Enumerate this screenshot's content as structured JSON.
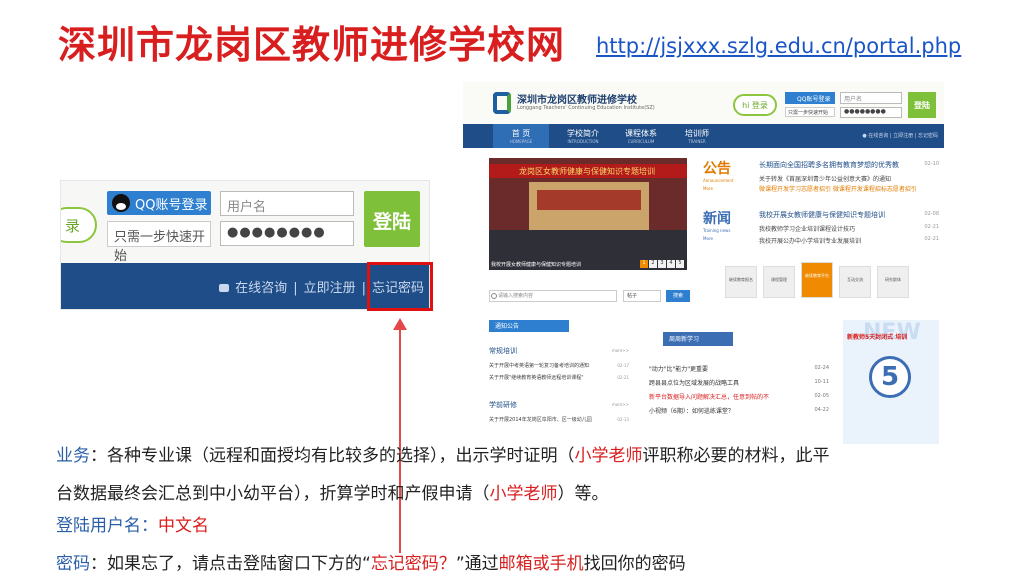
{
  "slide": {
    "title": "深圳市龙岗区教师进修学校网",
    "url": "http://jsjxxx.szlg.edu.cn/portal.php"
  },
  "zoom_login": {
    "hi_fragment": "录",
    "qq_login": "QQ账号登录",
    "quick_start_hint": "只需一步快速开始",
    "username_placeholder": "用户名",
    "password_value": "●●●●●●●●",
    "login_button": "登陆",
    "online_consult": "在线咨询",
    "separator": "|",
    "register_now": "立即注册",
    "forgot_password": "忘记密码"
  },
  "site": {
    "logo_cn": "深圳市龙岗区教师进修学校",
    "logo_en": "Longgang Teachers' Continuing Education Institute(SZ)",
    "hi_login": "hi 登录",
    "qq_login": "QQ账号登录",
    "qq_hint": "只需一步快速开始",
    "username": "用户名",
    "password": "●●●●●●●●",
    "login": "登陆",
    "nav": [
      {
        "label": "首 页",
        "sub": "HOMEPAGE"
      },
      {
        "label": "学校简介",
        "sub": "INTRODUCTION"
      },
      {
        "label": "课程体系",
        "sub": "CURRICULUM"
      },
      {
        "label": "培训师",
        "sub": "TRAINER"
      }
    ],
    "nav_right": "● 在线咨询 | 立即注册 | 忘记密码",
    "photo_banner": "龙岗区女教师健康与保健知识专题培训",
    "photo_caption": "我校开展女教师健康与保健知识专题培训",
    "pager": [
      "1",
      "2",
      "3",
      "4",
      "5"
    ],
    "notice_tag": "公告",
    "notice_sub": "Announcement",
    "notice_more": "More",
    "notice_lines": [
      {
        "text": "长期面向全国招聘多名拥有教育梦想的优秀教",
        "date": "02-10"
      },
      {
        "text": "关于转发《首届深圳青少年公益创意大赛》的通知",
        "date": ""
      },
      {
        "text": "微课程开发学习志愿者招引   微课程开发课程招标志愿者招引",
        "date": ""
      }
    ],
    "news_tag": "新闻",
    "news_sub": "Training news",
    "news_more": "More",
    "news_lines": [
      {
        "text": "我校开展女教师健康与保健知识专题培训",
        "date": "02-08"
      },
      {
        "text": "我校教师学习企业培训课程设计技巧",
        "date": "02-21"
      },
      {
        "text": "我校开展公办中小学培训专业发展培训",
        "date": "02-21"
      }
    ],
    "search_placeholder": "请输入搜索内容",
    "search_select": "帖子",
    "search_button": "搜索",
    "cards": [
      "继续教育报名",
      "课程管理",
      "继续教育平台",
      "互动交流",
      "研究群体"
    ],
    "notice_box": {
      "head": "通知公告",
      "cat1": "常规培训",
      "cat1_more": "more>>",
      "cat1_items": [
        {
          "text": "关于开展中考英语第一轮复习备考培训的通知",
          "date": "02-17"
        },
        {
          "text": "关于开展\"继续教育英语教师远程培训课程\"",
          "date": "02-21"
        }
      ],
      "cat2": "学前研修",
      "cat2_more": "more>>",
      "cat2_items": [
        {
          "text": "关于开展2014年龙岗区阜阳市、区一级幼儿园",
          "date": "02-13"
        }
      ]
    },
    "study_box": {
      "head": "周周新学习",
      "items": [
        {
          "text": "\"动力\"比\"能力\"更重要",
          "date": "02-24",
          "red": false
        },
        {
          "text": "跨县县点位为区域发展的战略工具",
          "date": "10-11",
          "red": false
        },
        {
          "text": "新平台数据导入问题解决汇总，任意到帖的不",
          "date": "02-05",
          "red": true
        },
        {
          "text": "小视频（6期）：如何巡练课堂？",
          "date": "04-22",
          "red": false
        }
      ]
    },
    "promo": {
      "title": "新教师5天封闭式 培训",
      "number": "5",
      "new_word": "NEW"
    }
  },
  "notes": {
    "business_label": "业务",
    "business_text_1": "：各种专业课（远程和面授均有比较多的选择），出示学时证明（",
    "primary_teacher_1": "小学老师",
    "business_text_2": "评职称必要的材料，此平",
    "business_text_3": "台数据最终会汇总到中小幼平台），折算学时和产假申请（",
    "primary_teacher_2": "小学老师",
    "business_text_4": "）等。",
    "username_label": "登陆用户名",
    "username_colon": "：",
    "username_value": "中文名",
    "password_label": "密码",
    "password_text_1": "：如果忘了，请点击登陆窗口下方的",
    "password_quote_open": "“",
    "forgot_phrase": "忘记密码？",
    "password_quote_close": "”",
    "password_text_2": "通过",
    "email_or_phone": "邮箱或手机",
    "password_text_3": "找回你的密码"
  }
}
